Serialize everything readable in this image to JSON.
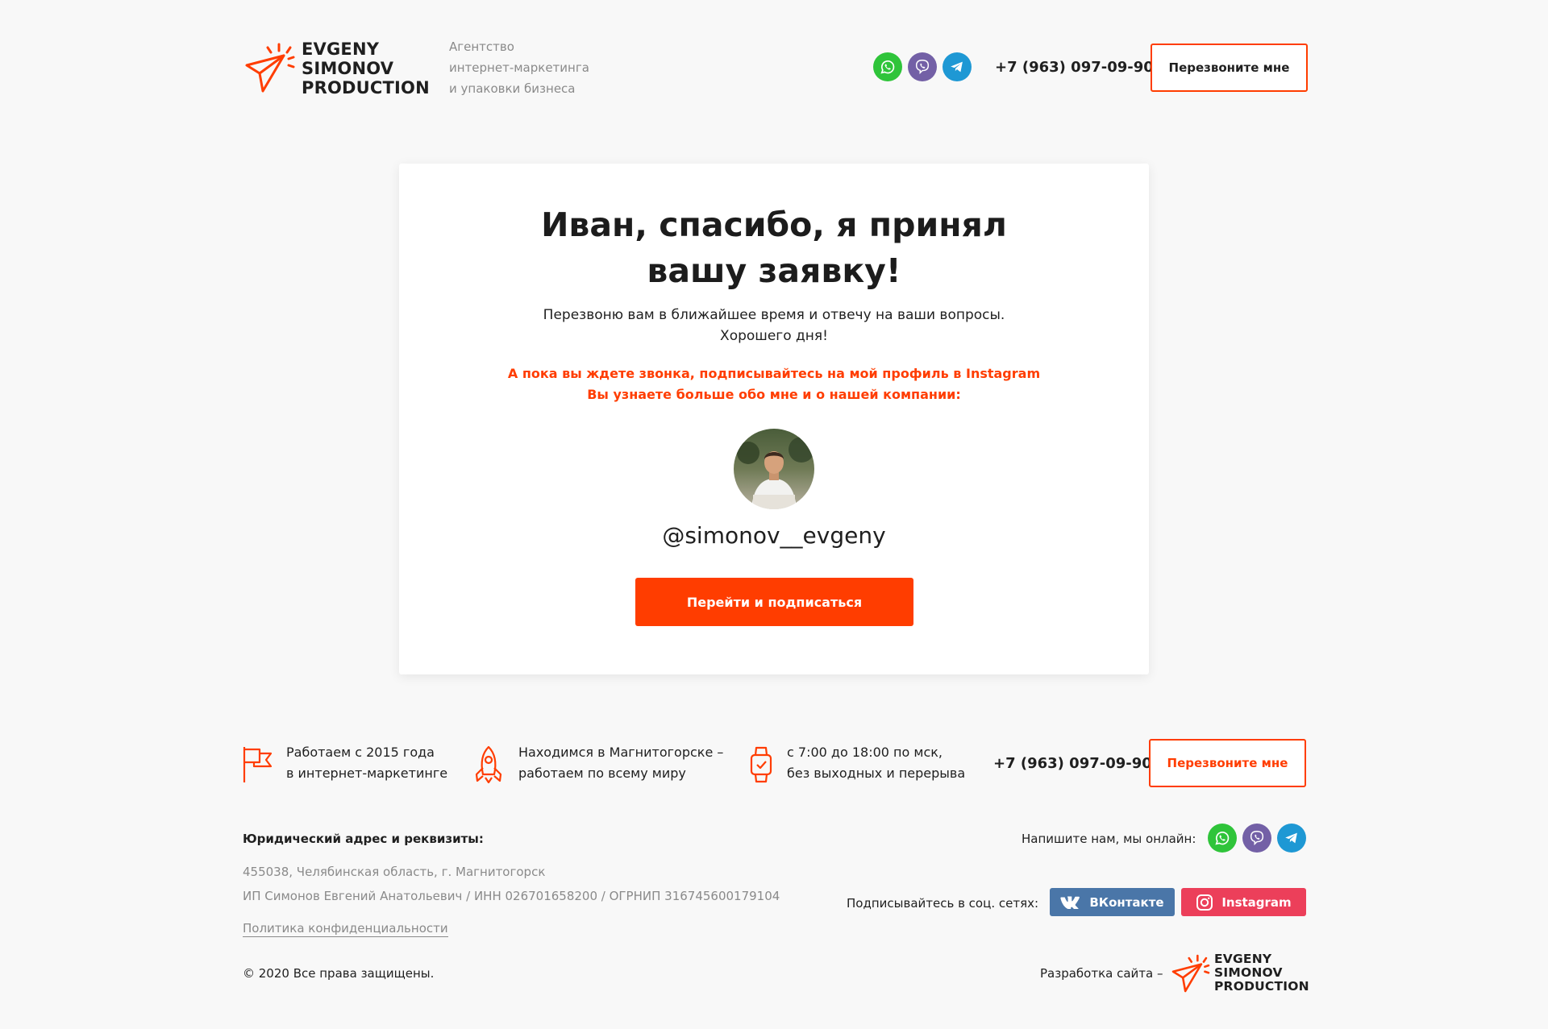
{
  "header": {
    "logo_lines": [
      "EVGENY",
      "SIMONOV",
      "PRODUCTION"
    ],
    "tagline_lines": [
      "Агентство",
      "интернет-маркетинга",
      "и упаковки бизнеса"
    ],
    "phone": "+7 (963) 097-09-90",
    "callback_label": "Перезвоните мне"
  },
  "card": {
    "title_line1": "Иван, спасибо, я принял",
    "title_line2": "вашу заявку!",
    "text_line1": "Перезвоню вам в ближайшее время и отвечу на ваши вопросы.",
    "text_line2": "Хорошего дня!",
    "accent_line1": "А пока вы ждете звонка, подписывайтесь на мой профиль в Instagram",
    "accent_line2": "Вы узнаете больше обо мне и о нашей компании:",
    "handle": "@simonov__evgeny",
    "subscribe_label": "Перейти и подписаться"
  },
  "footer": {
    "features": [
      {
        "icon": "flag-icon",
        "line1": "Работаем с 2015 года",
        "line2": "в интернет-маркетинге"
      },
      {
        "icon": "rocket-icon",
        "line1": "Находимся в Магнитогорске –",
        "line2": "работаем по всему миру"
      },
      {
        "icon": "watch-icon",
        "line1": "с 7:00 до 18:00 по мск,",
        "line2": "без выходных и перерыва"
      }
    ],
    "phone": "+7 (963) 097-09-90",
    "callback_label": "Перезвоните мне",
    "legal_title": "Юридический адрес и реквизиты:",
    "address": "455038, Челябинская область, г. Магнитогорск",
    "requisites": "ИП Симонов Евгений Анатольевич / ИНН 026701658200 / ОГРНИП 316745600179104",
    "policy_link": "Политика конфиденциальности",
    "copyright": "© 2020 Все права защищены.",
    "write_us": "Напишите нам, мы онлайн:",
    "subscribe_social": "Подписывайтесь в соц. сетях:",
    "vk_label": "ВКонтакте",
    "instagram_label": "Instagram",
    "dev_label": "Разработка сайта –",
    "dev_logo_lines": [
      "EVGENY",
      "SIMONOV",
      "PRODUCTION"
    ]
  },
  "colors": {
    "accent": "#ff3d00",
    "whatsapp": "#2fc43a",
    "viber": "#7360a6",
    "telegram": "#1e98d4",
    "vk": "#4a76a8",
    "instagram": "#ec3f5a"
  }
}
